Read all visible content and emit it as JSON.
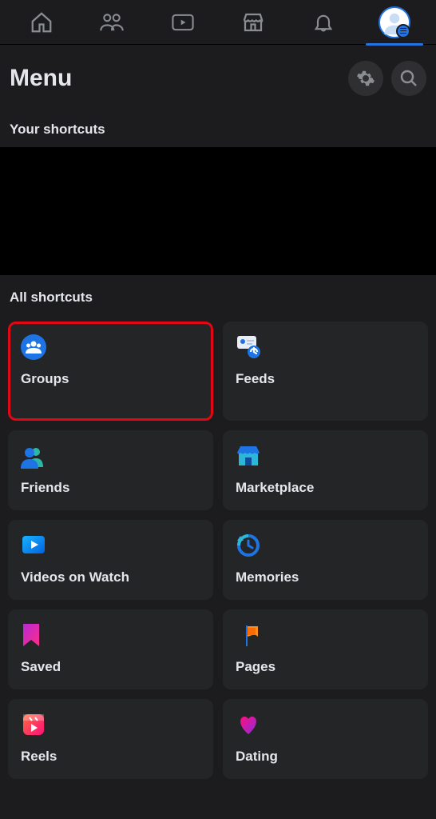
{
  "nav": {
    "items": [
      {
        "name": "home"
      },
      {
        "name": "friends"
      },
      {
        "name": "watch"
      },
      {
        "name": "marketplace"
      },
      {
        "name": "notifications"
      },
      {
        "name": "menu",
        "active": true
      }
    ]
  },
  "header": {
    "title": "Menu"
  },
  "sections": {
    "your_shortcuts": "Your shortcuts",
    "all_shortcuts": "All shortcuts"
  },
  "shortcuts": [
    {
      "label": "Groups",
      "icon": "groups",
      "highlighted": true
    },
    {
      "label": "Feeds",
      "icon": "feeds"
    },
    {
      "label": "Friends",
      "icon": "friends"
    },
    {
      "label": "Marketplace",
      "icon": "marketplace"
    },
    {
      "label": "Videos on Watch",
      "icon": "watch"
    },
    {
      "label": "Memories",
      "icon": "memories"
    },
    {
      "label": "Saved",
      "icon": "saved"
    },
    {
      "label": "Pages",
      "icon": "pages"
    },
    {
      "label": "Reels",
      "icon": "reels"
    },
    {
      "label": "Dating",
      "icon": "dating"
    }
  ],
  "colors": {
    "accent": "#2374e1",
    "highlight_border": "#e30613"
  }
}
